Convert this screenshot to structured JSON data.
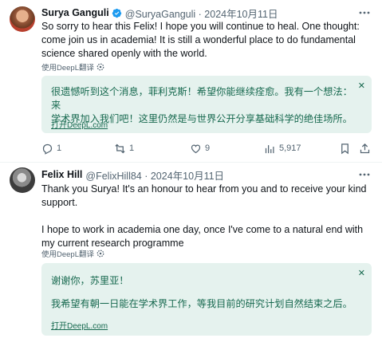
{
  "tweets": [
    {
      "author_name": "Surya Ganguli",
      "handle_date": "@SuryaGanguli · 2024年10月11日",
      "text_lines": [
        "So sorry to hear this Felix! I hope you will continue to heal. One thought:",
        "come join us in academia! It is still a wonderful place to do fundamental",
        "science shared openly with the world."
      ],
      "translate_label": "使用DeepL翻译",
      "translation_lines": [
        "很遗憾听到这个消息，菲利克斯！希望你能继续痊愈。我有一个想法：来",
        "学术界加入我们吧！这里仍然是与世界公开分享基础科学的绝佳场所。"
      ],
      "translation_link": "打开DeepL.com",
      "actions": {
        "replies": "1",
        "reposts": "1",
        "likes": "9",
        "views": "5,917"
      }
    },
    {
      "author_name": "Felix Hill",
      "handle_date": "@FelixHill84 · 2024年10月11日",
      "text_lines": [
        "Thank you Surya! It's an honour to hear from you and to  receive your kind",
        "support.",
        "",
        "I hope to work in academia one day, once I've come to a natural end with",
        "my current research programme"
      ],
      "translate_label": "使用DeepL翻译",
      "translation_lines": [
        "谢谢你，苏里亚！",
        "",
        "我希望有朝一日能在学术界工作，等我目前的研究计划自然结束之后。"
      ],
      "translation_link": "打开DeepL.com"
    }
  ],
  "colors": {
    "verified": "#1d9bf0",
    "translation_bg": "#e5f2ee",
    "translation_text": "#17694f",
    "secondary_text": "#536471"
  },
  "icons": [
    "more-icon",
    "verified-badge-icon",
    "gear-icon",
    "close-icon",
    "reply-icon",
    "repost-icon",
    "like-icon",
    "views-icon",
    "bookmark-icon",
    "share-icon"
  ]
}
